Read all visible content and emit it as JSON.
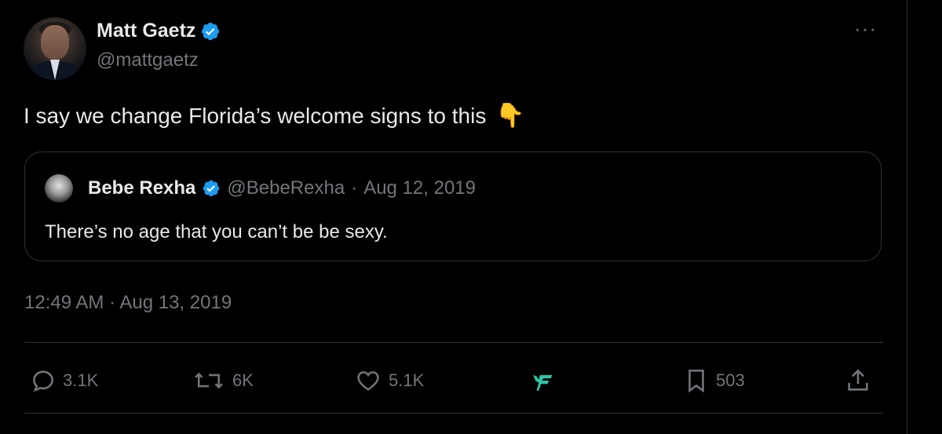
{
  "author": {
    "name": "Matt Gaetz",
    "handle": "@mattgaetz",
    "verified_color": "#1d9bf0"
  },
  "tweet": {
    "text": "I say we change Florida’s welcome signs to this",
    "emoji": "👇",
    "timestamp": "12:49 AM · Aug 13, 2019"
  },
  "quoted": {
    "name": "Bebe Rexha",
    "handle": "@BebeRexha",
    "separator": "·",
    "date": "Aug 12, 2019",
    "text": "There’s no age that you can’t be be sexy."
  },
  "actions": {
    "replies": "3.1K",
    "reposts": "6K",
    "likes": "5.1K",
    "bookmarks": "503"
  },
  "icons": {
    "more": "more-icon",
    "reply": "reply-icon",
    "repost": "repost-icon",
    "like": "heart-icon",
    "app": "app-logo-icon",
    "bookmark": "bookmark-icon",
    "share": "share-icon"
  },
  "colors": {
    "background": "#000000",
    "text": "#e7e9ea",
    "muted": "#71767b",
    "border": "#2f3336",
    "verified": "#1d9bf0",
    "app_logo": "#2ec4a5"
  }
}
